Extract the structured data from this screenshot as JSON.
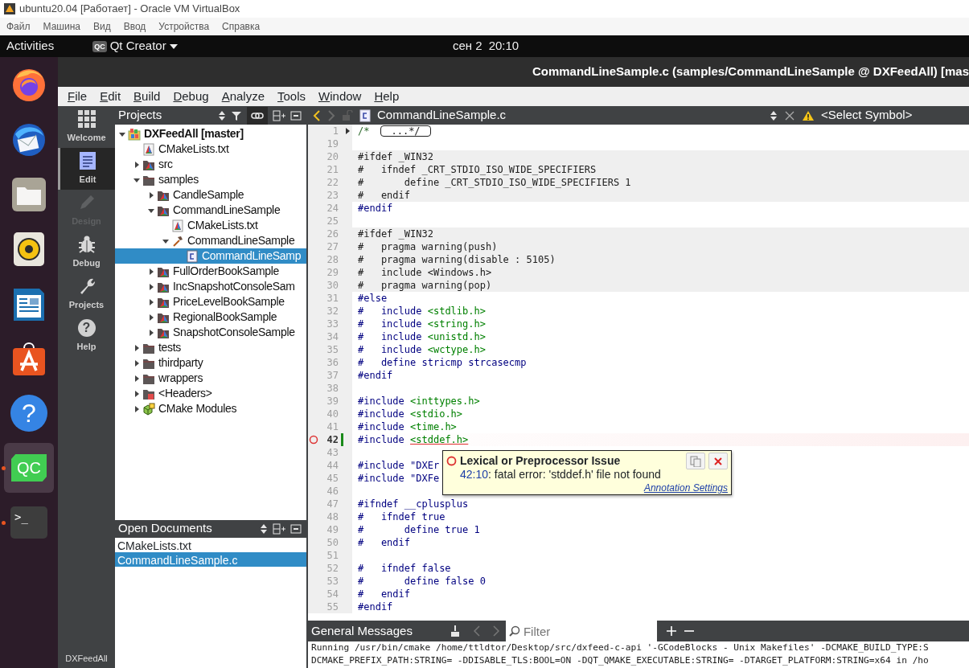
{
  "vm_window": {
    "title": "ubuntu20.04 [Работает] - Oracle VM VirtualBox",
    "menu": [
      "Файл",
      "Машина",
      "Вид",
      "Ввод",
      "Устройства",
      "Справка"
    ]
  },
  "top_bar": {
    "activities": "Activities",
    "app_badge": "QC",
    "app_name": "Qt Creator",
    "date": "сен 2",
    "time": "20:10"
  },
  "dock": [
    {
      "kind": "firefox",
      "running": false,
      "selected": false
    },
    {
      "kind": "thunderbird",
      "running": false,
      "selected": false
    },
    {
      "kind": "files",
      "running": false,
      "selected": false
    },
    {
      "kind": "rhythmbox",
      "running": false,
      "selected": false
    },
    {
      "kind": "writer",
      "running": false,
      "selected": false
    },
    {
      "kind": "software",
      "running": false,
      "selected": false
    },
    {
      "kind": "help",
      "label": "?",
      "running": false,
      "selected": false
    },
    {
      "kind": "qtcreator",
      "label": "QC",
      "running": true,
      "selected": true
    },
    {
      "kind": "terminal",
      "label": ">_",
      "running": true,
      "selected": false
    }
  ],
  "qt_window": {
    "title": "CommandLineSample.c (samples/CommandLineSample @ DXFeedAll) [mas",
    "menu": [
      "File",
      "Edit",
      "Build",
      "Debug",
      "Analyze",
      "Tools",
      "Window",
      "Help"
    ]
  },
  "modes": [
    {
      "kind": "welcome",
      "label": "Welcome",
      "selected": false,
      "disabled": false
    },
    {
      "kind": "edit",
      "label": "Edit",
      "selected": true,
      "disabled": false
    },
    {
      "kind": "design",
      "label": "Design",
      "selected": false,
      "disabled": true
    },
    {
      "kind": "debug",
      "label": "Debug",
      "selected": false,
      "disabled": false
    },
    {
      "kind": "projects",
      "label": "Projects",
      "selected": false,
      "disabled": false
    },
    {
      "kind": "help",
      "label": "Help",
      "icon_label": "?",
      "selected": false,
      "disabled": false
    }
  ],
  "active_project": "DXFeedAll",
  "projects": {
    "title": "Projects",
    "tree": [
      {
        "label": "DXFeedAll [master]",
        "kind": "project",
        "expanded": true,
        "selected": false,
        "children": [
          {
            "label": "CMakeLists.txt",
            "kind": "cmake-file",
            "selected": false
          },
          {
            "label": "src",
            "kind": "cmake-folder",
            "expanded": false,
            "selected": false
          },
          {
            "label": "samples",
            "kind": "folder",
            "expanded": true,
            "selected": false,
            "children": [
              {
                "label": "CandleSample",
                "kind": "cmake-folder",
                "expanded": false,
                "selected": false
              },
              {
                "label": "CommandLineSample",
                "kind": "cmake-folder",
                "expanded": true,
                "selected": false,
                "children": [
                  {
                    "label": "CMakeLists.txt",
                    "kind": "cmake-file",
                    "selected": false
                  },
                  {
                    "label": "CommandLineSample",
                    "kind": "target",
                    "expanded": true,
                    "selected": false,
                    "children": [
                      {
                        "label": "CommandLineSamp",
                        "kind": "c-file",
                        "selected": true
                      }
                    ]
                  }
                ]
              },
              {
                "label": "FullOrderBookSample",
                "kind": "cmake-folder",
                "expanded": false,
                "selected": false
              },
              {
                "label": "IncSnapshotConsoleSam",
                "kind": "cmake-folder",
                "expanded": false,
                "selected": false
              },
              {
                "label": "PriceLevelBookSample",
                "kind": "cmake-folder",
                "expanded": false,
                "selected": false
              },
              {
                "label": "RegionalBookSample",
                "kind": "cmake-folder",
                "expanded": false,
                "selected": false
              },
              {
                "label": "SnapshotConsoleSample",
                "kind": "cmake-folder",
                "expanded": false,
                "selected": false
              }
            ]
          },
          {
            "label": "tests",
            "kind": "folder",
            "expanded": false,
            "selected": false
          },
          {
            "label": "thirdparty",
            "kind": "folder",
            "expanded": false,
            "selected": false
          },
          {
            "label": "wrappers",
            "kind": "folder",
            "expanded": false,
            "selected": false
          },
          {
            "label": "<Headers>",
            "kind": "headers",
            "expanded": false,
            "selected": false
          },
          {
            "label": "CMake Modules",
            "kind": "modules",
            "expanded": false,
            "selected": false
          }
        ]
      }
    ]
  },
  "open_documents": {
    "title": "Open Documents",
    "items": [
      {
        "label": "CMakeLists.txt",
        "selected": false
      },
      {
        "label": "CommandLineSample.c",
        "selected": true
      }
    ]
  },
  "editor": {
    "file": "CommandLineSample.c",
    "symbol": "<Select Symbol>",
    "lines": [
      {
        "number": "1",
        "text": "/*",
        "fold": "...*/",
        "collapsed": true,
        "inactive": false
      },
      {
        "number": "19",
        "inactive": false
      },
      {
        "number": "20",
        "text": "#ifdef _WIN32",
        "inactive": true
      },
      {
        "number": "21",
        "text": "#   ifndef _CRT_STDIO_ISO_WIDE_SPECIFIERS",
        "inactive": true
      },
      {
        "number": "22",
        "text": "#       define _CRT_STDIO_ISO_WIDE_SPECIFIERS 1",
        "inactive": true
      },
      {
        "number": "23",
        "text": "#   endif",
        "inactive": true
      },
      {
        "number": "24",
        "text": "#endif",
        "inactive": false
      },
      {
        "number": "25",
        "inactive": false
      },
      {
        "number": "26",
        "text": "#ifdef _WIN32",
        "inactive": true
      },
      {
        "number": "27",
        "text": "#   pragma warning(push)",
        "inactive": true
      },
      {
        "number": "28",
        "text": "#   pragma warning(disable : 5105)",
        "inactive": true
      },
      {
        "number": "29",
        "text": "#   include <Windows.h>",
        "inactive": true
      },
      {
        "number": "30",
        "text": "#   pragma warning(pop)",
        "inactive": true
      },
      {
        "number": "31",
        "text": "#else",
        "inactive": false
      },
      {
        "number": "32",
        "text": "#   include ",
        "path": "<stdlib.h>",
        "inactive": false
      },
      {
        "number": "33",
        "text": "#   include ",
        "path": "<string.h>",
        "inactive": false
      },
      {
        "number": "34",
        "text": "#   include ",
        "path": "<unistd.h>",
        "inactive": false
      },
      {
        "number": "35",
        "text": "#   include ",
        "path": "<wctype.h>",
        "inactive": false
      },
      {
        "number": "36",
        "text": "#   define stricmp strcasecmp",
        "inactive": false
      },
      {
        "number": "37",
        "text": "#endif",
        "inactive": false
      },
      {
        "number": "38",
        "inactive": false
      },
      {
        "number": "39",
        "text": "#include ",
        "path": "<inttypes.h>",
        "inactive": false
      },
      {
        "number": "40",
        "text": "#include ",
        "path": "<stdio.h>",
        "inactive": false
      },
      {
        "number": "41",
        "text": "#include ",
        "path": "<time.h>",
        "inactive": false
      },
      {
        "number": "42",
        "text": "#include ",
        "path": "<stddef.h>",
        "inactive": false,
        "error": true,
        "modified": true
      },
      {
        "number": "43",
        "inactive": false
      },
      {
        "number": "44",
        "text": "#include \"DXEr",
        "inactive": false
      },
      {
        "number": "45",
        "text": "#include \"DXFe",
        "inactive": false
      },
      {
        "number": "46",
        "inactive": false
      },
      {
        "number": "47",
        "text": "#ifndef __cplusplus",
        "inactive": false
      },
      {
        "number": "48",
        "text": "#   ifndef true",
        "inactive": false
      },
      {
        "number": "49",
        "text": "#       define true 1",
        "inactive": false
      },
      {
        "number": "50",
        "text": "#   endif",
        "inactive": false
      },
      {
        "number": "51",
        "inactive": false
      },
      {
        "number": "52",
        "text": "#   ifndef false",
        "inactive": false
      },
      {
        "number": "53",
        "text": "#       define false 0",
        "inactive": false
      },
      {
        "number": "54",
        "text": "#   endif",
        "inactive": false
      },
      {
        "number": "55",
        "text": "#endif",
        "inactive": false
      }
    ],
    "tooltip": {
      "title": "Lexical or Preprocessor Issue",
      "location": "42:10",
      "message": ": fatal error: 'stddef.h' file not found",
      "link": "Annotation Settings"
    }
  },
  "messages": {
    "title": "General Messages",
    "filter_placeholder": "Filter",
    "output": [
      "Running /usr/bin/cmake /home/ttldtor/Desktop/src/dxfeed-c-api '-GCodeBlocks - Unix Makefiles' -DCMAKE_BUILD_TYPE:S",
      "DCMAKE_PREFIX_PATH:STRING= -DDISABLE_TLS:BOOL=ON -DQT_QMAKE_EXECUTABLE:STRING= -DTARGET_PLATFORM:STRING=x64 in /ho"
    ]
  }
}
